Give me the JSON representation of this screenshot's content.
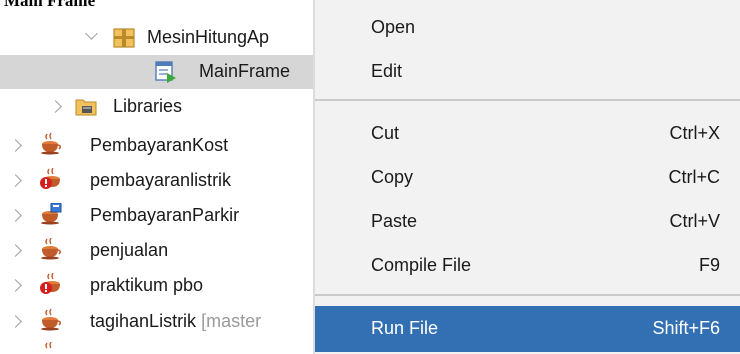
{
  "tree": {
    "top_partial": "Main Frame",
    "items": [
      {
        "label": "MesinHitungAp",
        "icon": "package-icon",
        "expanded": true
      },
      {
        "label": "MainFrame",
        "icon": "java-form-icon",
        "selected": true
      },
      {
        "label": "Libraries",
        "icon": "libraries-folder-icon",
        "expanded": false
      },
      {
        "label": "PembayaranKost",
        "icon": "java-project-icon"
      },
      {
        "label": "pembayaranlistrik",
        "icon": "java-project-error-icon"
      },
      {
        "label": "PembayaranParkir",
        "icon": "java-project-vcs-icon"
      },
      {
        "label": "penjualan",
        "icon": "java-project-icon"
      },
      {
        "label": "praktikum pbo",
        "icon": "java-project-error-icon"
      },
      {
        "label": "tagihanListrik",
        "branch": "[master",
        "icon": "java-project-icon"
      }
    ]
  },
  "context_menu": {
    "open": {
      "label": "Open"
    },
    "edit": {
      "label": "Edit"
    },
    "cut": {
      "label": "Cut",
      "shortcut": "Ctrl+X"
    },
    "copy": {
      "label": "Copy",
      "shortcut": "Ctrl+C"
    },
    "paste": {
      "label": "Paste",
      "shortcut": "Ctrl+V"
    },
    "compile_file": {
      "label": "Compile File",
      "shortcut": "F9"
    },
    "run_file": {
      "label": "Run File",
      "shortcut": "Shift+F6"
    }
  },
  "colors": {
    "menu_bg": "#f2f2f2",
    "highlight": "#3370b3",
    "selected_row": "#d6d6d6"
  }
}
